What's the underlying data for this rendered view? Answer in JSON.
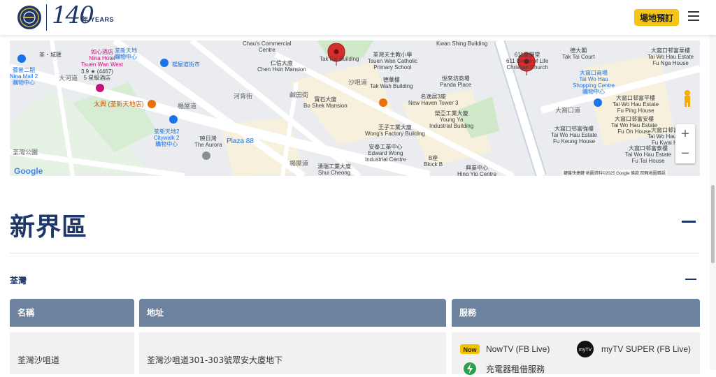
{
  "header": {
    "logo_number": "140",
    "logo_years": "年 YEARS",
    "book_button": "場地預訂"
  },
  "map": {
    "labels": {
      "chaus_commercial": "Chau's Commercial\nCentre",
      "tak_fai": "Tak Fai Building",
      "kwan_shing": "Kwan Shing Building",
      "church_611": "611靈糧堂\n611 Bread of Life\nChristian Church",
      "tak_tai": "德大閣\nTak Tai Court",
      "tai_wo_hau_estate_1": "大窩口邨富華樓\nTai Wo Hau Estate\nFu Nga House",
      "zen_wan": "荃・城匯",
      "ninamall": "薈縈二期\nNina Mall 2\n購物中心",
      "nina_hotel": "如心酒店\nNina Hotel\nTsuen Wan West",
      "nina_rating": "3.9 ★ (4467)\n5 星級酒店",
      "tsuen_sun": "荃新天地\n購物中心",
      "yeung_uk": "楊屋道街市",
      "chen_hsin": "仁信大廈\nChen Hsin Mansion",
      "catholic_school": "荃灣天主教小學\nTsuen Wan Catholic\nPrimary School",
      "tak_wah": "德華樓\nTak Wah Building",
      "panda_place": "悅來坊商場\nPanda Place",
      "tai_wo_hau_shopping": "大窩口商場\nTai Wo Hau\nShopping Centre\n購物中心",
      "taihing": "太興 (荃新天地店)",
      "bo_shek": "寶石大廈\nBo Shek Mansion",
      "new_haven": "名逸居3座\nNew Haven Tower 3",
      "young_ya": "榮亞工業大廈\nYoung Ya\nIndustrial Building",
      "wongs_factory": "王子工業大廈\nWong's Factory Building",
      "fu_ping": "大窩口邨富平樓\nTai Wo Hau Estate\nFu Ping House",
      "fu_on": "大窩口邨富安樓\nTai Wo Hau Estate\nFu On House",
      "fu_keung": "大窩口邨富強樓\nTai Wo Hau Estate\nFu Keung House",
      "tai_wo_hau_estate_2": "大窩口邨富泰樓\nTai Wo Hau Estate\nFu Tai House",
      "citywalk": "荃新天地2\nCitywalk 2\n購物中心",
      "plaza88": "Plaza 88",
      "the_aurora": "映日灣\nThe Aurora",
      "edward_wong": "安泰工業中心\nEdward Wong\nIndustrial Centre",
      "block_b": "B座\nBlock B",
      "shui_cheong": "湧瑞工業大廈\nShui Cheong",
      "hing_yip": "興業中心\nHing Yip Centre",
      "fu_kwai": "大窩口邨富葵樓\nTai Wo Hau Estate\nFu Kwai House",
      "tsuen_wan_park": "荃灣公園",
      "tai_ho_road": "大河道",
      "yeung_uk_road_1": "楊屋道",
      "yeung_uk_road_2": "楊屋道",
      "ho_pak_st": "河背街",
      "sha_tsui_road": "沙咀道",
      "kwu_tei_st": "鹹田街",
      "tai_wo_hau_road": "大窩口道",
      "google": "Google",
      "footer": "鍵盤快捷鍵    地圖資料©2025 Google    條款    回報地圖錯誤"
    },
    "zoom_in": "+",
    "zoom_out": "−"
  },
  "region": {
    "title": "新界區",
    "district": "荃灣"
  },
  "table": {
    "headers": [
      "名稱",
      "地址",
      "服務"
    ],
    "rows": [
      {
        "name": "荃灣沙咀道",
        "address": "荃灣沙咀道301-303號眾安大廈地下",
        "services": [
          "NowTV (FB Live)",
          "myTV SUPER (FB Live)",
          "充電器租借服務"
        ]
      }
    ]
  },
  "colors": {
    "brand_navy": "#1f3768",
    "accent_yellow": "#f5c518",
    "table_header": "#6e83a0",
    "map_pin": "#d32f2f"
  }
}
